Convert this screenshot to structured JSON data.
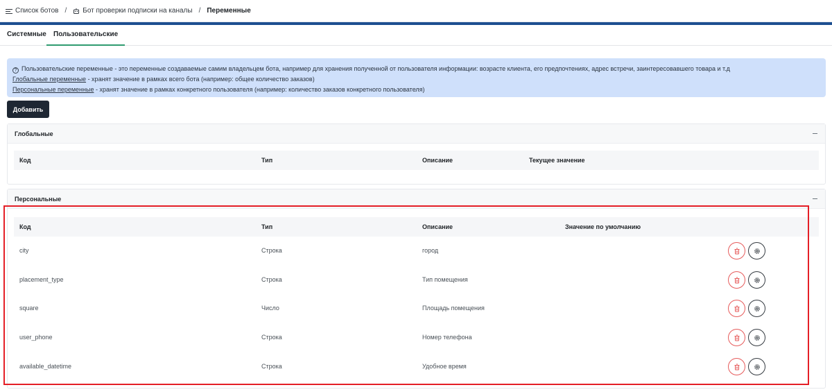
{
  "breadcrumb": {
    "items": [
      "Список ботов",
      "Бот проверки подписки на каналы"
    ],
    "separator": "/",
    "current": "Переменные"
  },
  "tabs": [
    "Системные",
    "Пользовательские"
  ],
  "active_tab": "Пользовательские",
  "info": {
    "line1": "Пользовательские переменные - это переменные создаваемые самим владельцем бота, например для хранения полученной от пользователя информации: возрасте клиента, его предпочтениях, адрес встречи, заинтересовавшего товара и т.д",
    "global_link": "Глобальные переменные",
    "global_text": " - хранят значение в рамках всего бота (например: общее количество заказов)",
    "personal_link": "Персональные переменные",
    "personal_text": " - хранят значение в рамках конкретного пользователя (например: количество заказов конкретного пользователя)"
  },
  "add_button": "Добавить",
  "global_panel": {
    "title": "Глобальные",
    "columns": [
      "Код",
      "Тип",
      "Описание",
      "Текущее значение"
    ]
  },
  "personal_panel": {
    "title": "Персональные",
    "columns": [
      "Код",
      "Тип",
      "Описание",
      "Значение по умолчанию"
    ],
    "rows": [
      {
        "code": "city",
        "type": "Строка",
        "description": "город"
      },
      {
        "code": "placement_type",
        "type": "Строка",
        "description": "Тип помещения"
      },
      {
        "code": "square",
        "type": "Число",
        "description": "Площадь помещения"
      },
      {
        "code": "user_phone",
        "type": "Строка",
        "description": "Номер телефона"
      },
      {
        "code": "available_datetime",
        "type": "Строка",
        "description": "Удобное время"
      }
    ]
  },
  "colors": {
    "header_band": "#1d4f91",
    "info_bg": "#cfe0fb",
    "add_button_bg": "#1e2733",
    "active_tab_underline": "#2f9b6f",
    "delete": "#e65a5a",
    "highlight": "#e41e26"
  },
  "icons": [
    "menu-icon",
    "bot-icon",
    "question-circle-icon",
    "collapse-icon",
    "trash-icon",
    "gear-icon"
  ]
}
